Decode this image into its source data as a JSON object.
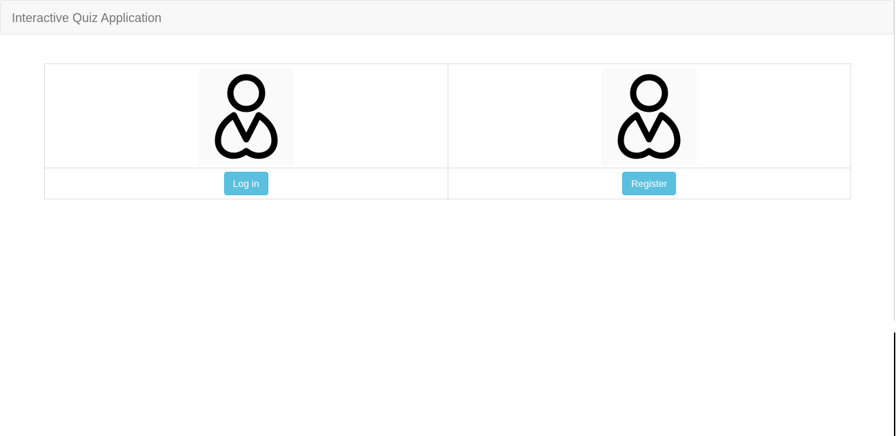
{
  "navbar": {
    "brand": "Interactive Quiz Application"
  },
  "options": [
    {
      "icon": "user-icon",
      "button_label": "Log in"
    },
    {
      "icon": "user-icon",
      "button_label": "Register"
    }
  ],
  "colors": {
    "navbar_bg": "#f8f8f8",
    "brand_text": "#777777",
    "button_bg": "#5bc0de",
    "table_border": "#dddddd"
  }
}
